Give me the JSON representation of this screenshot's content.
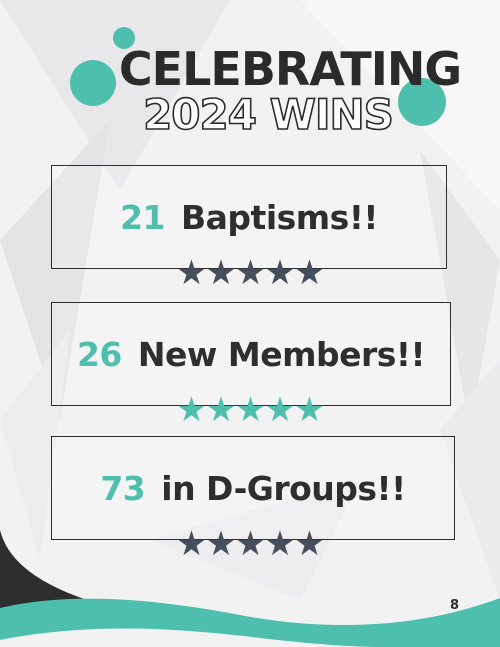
{
  "title": {
    "line1": "CELEBRATING",
    "line2": "2024 WINS"
  },
  "wins": [
    {
      "number": "21",
      "label": "Baptisms!!",
      "stars": "★★★★★",
      "star_color": "#454e5a"
    },
    {
      "number": "26",
      "label": "New Members!!",
      "stars": "★★★★★",
      "star_color": "#4fbfad"
    },
    {
      "number": "73",
      "label": "in D-Groups!!",
      "stars": "★★★★★",
      "star_color": "#454e5a"
    }
  ],
  "page_number": "8",
  "colors": {
    "accent": "#4fbfad",
    "dark": "#2e2e2e",
    "star_dark": "#454e5a"
  }
}
